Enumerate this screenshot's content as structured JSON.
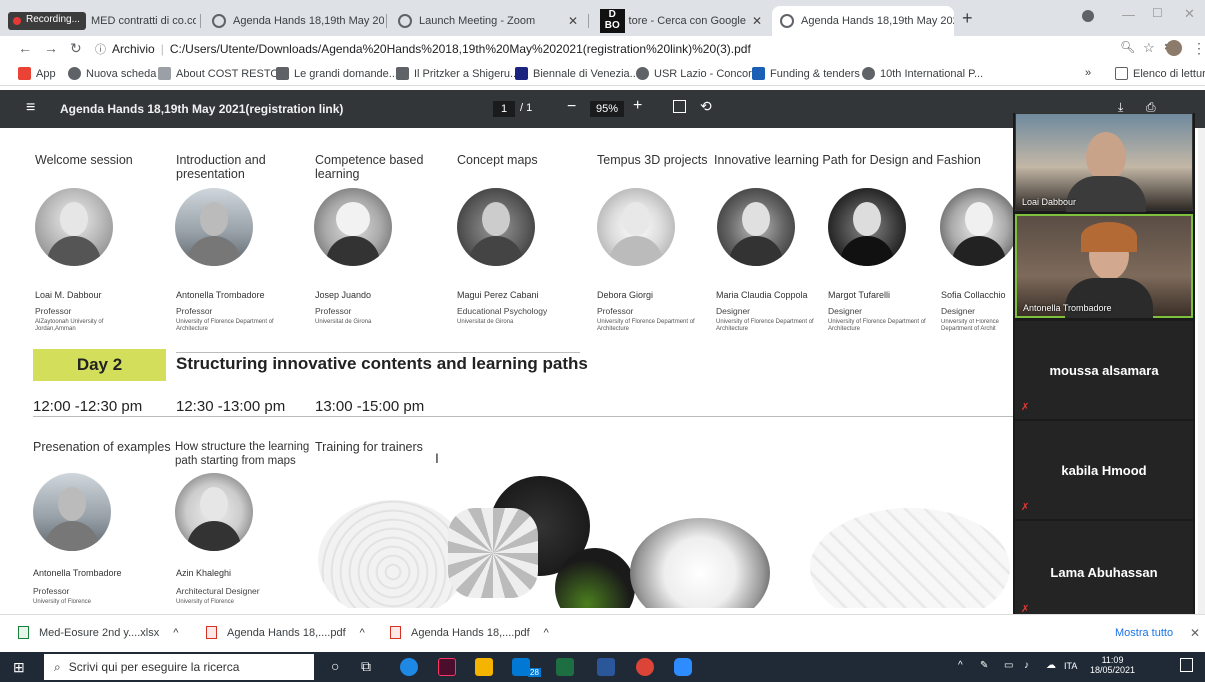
{
  "recording": "Recording...",
  "tabs": [
    {
      "label": "MED contratti di co.co.c"
    },
    {
      "label": "Agenda Hands 18,19th May 2021"
    },
    {
      "label": "Launch Meeting - Zoom"
    },
    {
      "label": "tore - Cerca con Google"
    },
    {
      "label": "Agenda Hands 18,19th May 2021"
    }
  ],
  "address": {
    "prefix": "Archivio",
    "url": "C:/Users/Utente/Downloads/Agenda%20Hands%2018,19th%20May%202021(registration%20link)%20(3).pdf"
  },
  "bookmarks": [
    "App",
    "Nuova scheda",
    "About COST RESTO...",
    "Le grandi domande...",
    "Il Pritzker a Shigeru...",
    "Biennale di Venezia...",
    "USR Lazio - Concor...",
    "Funding & tenders",
    "10th International P...",
    "Elenco di lettura"
  ],
  "pdf": {
    "title": "Agenda Hands 18,19th May 2021(registration link)",
    "page": "1",
    "total": "/ 1",
    "zoom": "95%"
  },
  "sessions_row1": [
    "Welcome session",
    "Introduction and presentation",
    "Competence based learning",
    "Concept maps",
    "Tempus 3D projects",
    "Innovative learning Path for Design and Fashion"
  ],
  "people_row1": [
    {
      "name": "Loai M. Dabbour",
      "role": "Professor",
      "aff": "AlZaytoonah University of Jordan,Amman"
    },
    {
      "name": "Antonella Trombadore",
      "role": "Professor",
      "aff": "University of Florence Department of Architecture"
    },
    {
      "name": "Josep Juando",
      "role": "Professor",
      "aff": "Universitat de Girona"
    },
    {
      "name": "Magui Perez Cabani",
      "role": "Educational Psychology",
      "aff": "Universitat de Girona"
    },
    {
      "name": "Debora Giorgi",
      "role": "Professor",
      "aff": "University of Florence Department of Architecture"
    },
    {
      "name": "Maria Claudia Coppola",
      "role": "Designer",
      "aff": "University of Florence Department of Architecture"
    },
    {
      "name": "Margot Tufarelli",
      "role": "Designer",
      "aff": "University of Florence Department of Architecture"
    },
    {
      "name": "Sofia Collacchio",
      "role": "Designer",
      "aff": "University of Florence Department of Archit"
    }
  ],
  "day": {
    "label": "Day 2",
    "heading": "Structuring innovative contents and learning paths"
  },
  "times": [
    "12:00 -12:30 pm",
    "12:30 -13:00 pm",
    "13:00 -15:00 pm"
  ],
  "sessions_row2": [
    "Presenation of examples",
    "How structure the learning path starting from maps",
    "Training for trainers"
  ],
  "people_row2": [
    {
      "name": "Antonella Trombadore",
      "role": "Professor",
      "aff": "University of Florence"
    },
    {
      "name": "Azin Khaleghi",
      "role": "Architectural Designer",
      "aff": "University of Florence"
    }
  ],
  "zoom": {
    "videos": [
      "Loai Dabbour",
      "Antonella Trombadore"
    ],
    "participants": [
      "moussa alsamara",
      "kabila Hmood",
      "Lama Abuhassan"
    ]
  },
  "downloads": [
    "Med-Eosure 2nd y....xlsx",
    "Agenda Hands 18,....pdf",
    "Agenda Hands 18,....pdf"
  ],
  "show_all": "Mostra tutto",
  "taskbar": {
    "search": "Scrivi qui per eseguire la ricerca",
    "lang": "ITA",
    "time": "11:09",
    "date": "18/05/2021",
    "badge": "28"
  }
}
